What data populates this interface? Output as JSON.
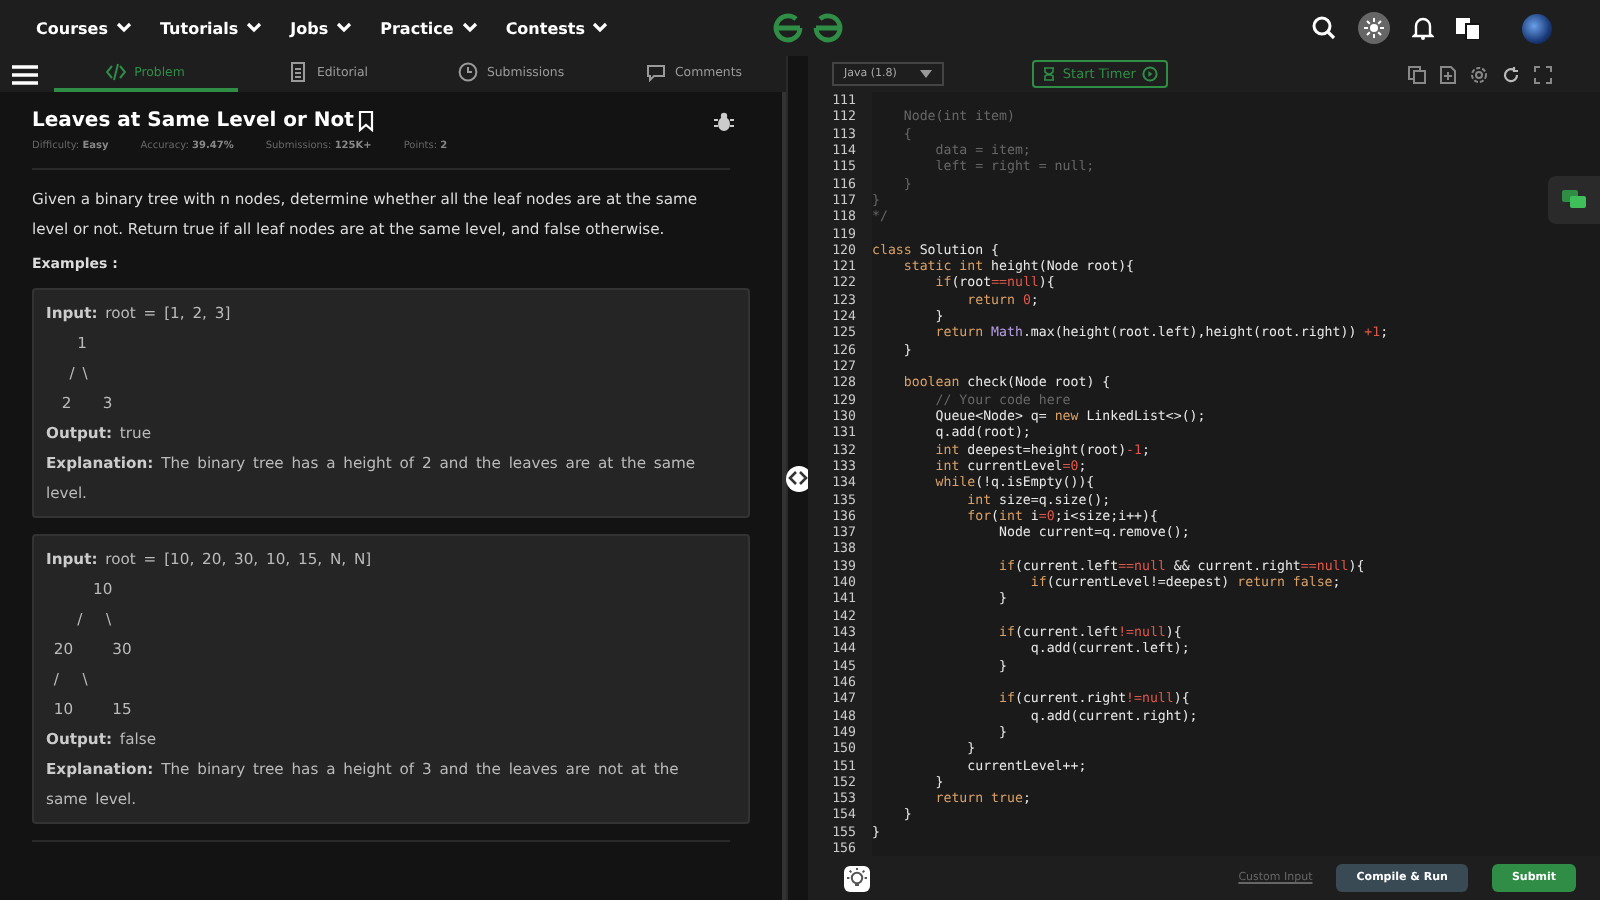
{
  "nav": {
    "menus": [
      "Courses",
      "Tutorials",
      "Jobs",
      "Practice",
      "Contests"
    ]
  },
  "tabs": [
    {
      "label": "Problem",
      "selected": true
    },
    {
      "label": "Editorial",
      "selected": false
    },
    {
      "label": "Submissions",
      "selected": false
    },
    {
      "label": "Comments",
      "selected": false
    }
  ],
  "problem": {
    "title": "Leaves at Same Level or Not",
    "meta": [
      {
        "label": "Difficulty:",
        "value": "Easy"
      },
      {
        "label": "Accuracy:",
        "value": "39.47%"
      },
      {
        "label": "Submissions:",
        "value": "125K+"
      },
      {
        "label": "Points:",
        "value": "2"
      }
    ],
    "description": "Given a binary tree with n nodes, determine whether all the leaf nodes are at the same level or not. Return true if all leaf nodes are at the same level, and false otherwise.",
    "examples_heading": "Examples :",
    "examples": [
      {
        "input_label": "Input:",
        "input": "root = [1, 2, 3]",
        "tree": [
          "    1",
          "   / \\",
          "  2    3"
        ],
        "output_label": "Output:",
        "output": "true",
        "explanation_label": "Explanation:",
        "explanation": "The binary tree has a height of 2 and the leaves are at the same level."
      },
      {
        "input_label": "Input:",
        "input": "root = [10, 20, 30, 10, 15, N, N]",
        "tree": [
          "      10",
          "    /   \\",
          " 20     30",
          " /   \\",
          " 10     15"
        ],
        "output_label": "Output:",
        "output": "false",
        "explanation_label": "Explanation:",
        "explanation": "The binary tree has a height of 3 and the leaves are not at the same level."
      }
    ]
  },
  "editor": {
    "language": "Java (1.8)",
    "timer": "Start Timer",
    "lines": [
      {
        "no": "111"
      },
      {
        "no": "112",
        "code": [
          {
            "kind": "comment",
            "text": "    Node(int item)"
          }
        ]
      },
      {
        "no": "113",
        "code": [
          {
            "kind": "comment",
            "text": "    {"
          }
        ]
      },
      {
        "no": "114",
        "code": [
          {
            "kind": "comment",
            "text": "        data = item;"
          }
        ]
      },
      {
        "no": "115",
        "code": [
          {
            "kind": "comment",
            "text": "        left = right = null;"
          }
        ]
      },
      {
        "no": "116",
        "code": [
          {
            "kind": "comment",
            "text": "    }"
          }
        ]
      },
      {
        "no": "117",
        "code": [
          {
            "kind": "comment",
            "text": "}"
          }
        ]
      },
      {
        "no": "118",
        "code": [
          {
            "kind": "comment",
            "text": "*/"
          }
        ]
      },
      {
        "no": "119"
      },
      {
        "no": "120",
        "code": [
          {
            "kind": "keyword",
            "text": "class"
          },
          {
            "kind": "plain",
            "text": " Solution {"
          }
        ]
      },
      {
        "no": "121",
        "code": [
          {
            "kind": "keyword",
            "text": "    static int"
          },
          {
            "kind": "plain",
            "text": " height(Node root){"
          }
        ]
      },
      {
        "no": "122",
        "code": [
          {
            "kind": "keyword",
            "text": "        if"
          },
          {
            "kind": "plain",
            "text": "(root"
          },
          {
            "kind": "literal",
            "text": "==null"
          },
          {
            "kind": "plain",
            "text": "){"
          }
        ]
      },
      {
        "no": "123",
        "code": [
          {
            "kind": "keyword",
            "text": "            return"
          },
          {
            "kind": "literal",
            "text": " 0"
          },
          {
            "kind": "plain",
            "text": ";"
          }
        ]
      },
      {
        "no": "124",
        "code": [
          {
            "kind": "plain",
            "text": "        }"
          }
        ]
      },
      {
        "no": "125",
        "code": [
          {
            "kind": "keyword",
            "text": "        return"
          },
          {
            "kind": "class",
            "text": " Math"
          },
          {
            "kind": "plain",
            "text": ".max(height(root.left),height(root.right)) "
          },
          {
            "kind": "literal",
            "text": "+1"
          },
          {
            "kind": "plain",
            "text": ";"
          }
        ]
      },
      {
        "no": "126",
        "code": [
          {
            "kind": "plain",
            "text": "    }"
          }
        ]
      },
      {
        "no": "127"
      },
      {
        "no": "128",
        "code": [
          {
            "kind": "keyword",
            "text": "    boolean"
          },
          {
            "kind": "plain",
            "text": " check(Node root) {"
          }
        ]
      },
      {
        "no": "129",
        "code": [
          {
            "kind": "comment",
            "text": "        // Your code here"
          }
        ]
      },
      {
        "no": "130",
        "code": [
          {
            "kind": "plain",
            "text": "        Queue<Node> q= "
          },
          {
            "kind": "keyword",
            "text": "new"
          },
          {
            "kind": "plain",
            "text": " LinkedList<>();"
          }
        ]
      },
      {
        "no": "131",
        "code": [
          {
            "kind": "plain",
            "text": "        q.add(root);"
          }
        ]
      },
      {
        "no": "132",
        "code": [
          {
            "kind": "keyword",
            "text": "        int"
          },
          {
            "kind": "plain",
            "text": " deepest=height(root)"
          },
          {
            "kind": "literal",
            "text": "-1"
          },
          {
            "kind": "plain",
            "text": ";"
          }
        ]
      },
      {
        "no": "133",
        "code": [
          {
            "kind": "keyword",
            "text": "        int"
          },
          {
            "kind": "plain",
            "text": " currentLevel"
          },
          {
            "kind": "literal",
            "text": "=0"
          },
          {
            "kind": "plain",
            "text": ";"
          }
        ]
      },
      {
        "no": "134",
        "code": [
          {
            "kind": "keyword",
            "text": "        while"
          },
          {
            "kind": "plain",
            "text": "(!q.isEmpty()){"
          }
        ]
      },
      {
        "no": "135",
        "code": [
          {
            "kind": "keyword",
            "text": "            int"
          },
          {
            "kind": "plain",
            "text": " size=q.size();"
          }
        ]
      },
      {
        "no": "136",
        "code": [
          {
            "kind": "keyword",
            "text": "            for"
          },
          {
            "kind": "plain",
            "text": "("
          },
          {
            "kind": "keyword",
            "text": "int"
          },
          {
            "kind": "plain",
            "text": " i"
          },
          {
            "kind": "literal",
            "text": "=0"
          },
          {
            "kind": "plain",
            "text": ";i<size;i++){"
          }
        ]
      },
      {
        "no": "137",
        "code": [
          {
            "kind": "plain",
            "text": "                Node current=q.remove();"
          }
        ]
      },
      {
        "no": "138"
      },
      {
        "no": "139",
        "code": [
          {
            "kind": "keyword",
            "text": "                if"
          },
          {
            "kind": "plain",
            "text": "(current.left"
          },
          {
            "kind": "literal",
            "text": "==null"
          },
          {
            "kind": "plain",
            "text": " && current.right"
          },
          {
            "kind": "literal",
            "text": "==null"
          },
          {
            "kind": "plain",
            "text": "){"
          }
        ]
      },
      {
        "no": "140",
        "code": [
          {
            "kind": "keyword",
            "text": "                    if"
          },
          {
            "kind": "plain",
            "text": "(currentLevel!=deepest) "
          },
          {
            "kind": "keyword",
            "text": "return false"
          },
          {
            "kind": "plain",
            "text": ";"
          }
        ]
      },
      {
        "no": "141",
        "code": [
          {
            "kind": "plain",
            "text": "                }"
          }
        ]
      },
      {
        "no": "142"
      },
      {
        "no": "143",
        "code": [
          {
            "kind": "keyword",
            "text": "                if"
          },
          {
            "kind": "plain",
            "text": "(current.left"
          },
          {
            "kind": "literal",
            "text": "!=null"
          },
          {
            "kind": "plain",
            "text": "){"
          }
        ]
      },
      {
        "no": "144",
        "code": [
          {
            "kind": "plain",
            "text": "                    q.add(current.left);"
          }
        ]
      },
      {
        "no": "145",
        "code": [
          {
            "kind": "plain",
            "text": "                }"
          }
        ]
      },
      {
        "no": "146"
      },
      {
        "no": "147",
        "code": [
          {
            "kind": "keyword",
            "text": "                if"
          },
          {
            "kind": "plain",
            "text": "(current.right"
          },
          {
            "kind": "literal",
            "text": "!=null"
          },
          {
            "kind": "plain",
            "text": "){"
          }
        ]
      },
      {
        "no": "148",
        "code": [
          {
            "kind": "plain",
            "text": "                    q.add(current.right);"
          }
        ]
      },
      {
        "no": "149",
        "code": [
          {
            "kind": "plain",
            "text": "                }"
          }
        ]
      },
      {
        "no": "150",
        "code": [
          {
            "kind": "plain",
            "text": "            }"
          }
        ]
      },
      {
        "no": "151",
        "code": [
          {
            "kind": "plain",
            "text": "            currentLevel++;"
          }
        ]
      },
      {
        "no": "152",
        "code": [
          {
            "kind": "plain",
            "text": "        }"
          }
        ]
      },
      {
        "no": "153",
        "code": [
          {
            "kind": "keyword",
            "text": "        return true"
          },
          {
            "kind": "plain",
            "text": ";"
          }
        ]
      },
      {
        "no": "154",
        "code": [
          {
            "kind": "plain",
            "text": "    }"
          }
        ]
      },
      {
        "no": "155",
        "code": [
          {
            "kind": "plain",
            "text": "}"
          }
        ]
      },
      {
        "no": "156"
      }
    ]
  },
  "footer": {
    "custom_input": "Custom Input",
    "compile": "Compile & Run",
    "submit": "Submit"
  }
}
